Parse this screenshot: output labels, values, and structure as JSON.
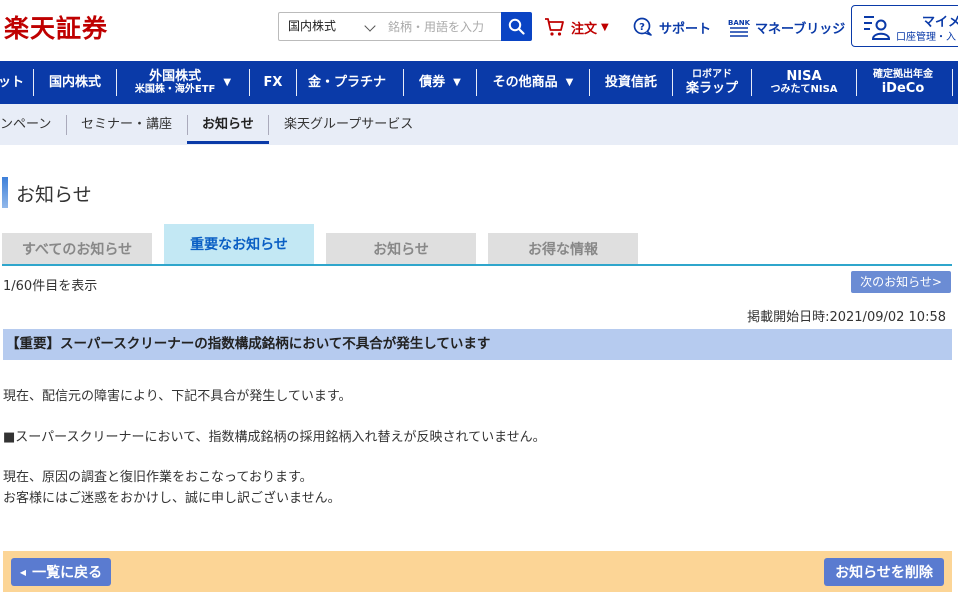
{
  "header": {
    "logo": "楽天証券",
    "search": {
      "category": "国内株式",
      "placeholder": "銘柄・用語を入力"
    },
    "order_label": "注文",
    "support_label": "サポート",
    "bridge_label": "マネーブリッジ",
    "mypage_title": "マイメ",
    "mypage_sub": "口座管理・入",
    "icons": {
      "search": "search-icon",
      "cart": "cart-icon",
      "support": "chat-question-icon",
      "bank": "bank-icon",
      "mypage": "user-list-icon"
    },
    "accent_color": "#bf0000",
    "brand_color": "#0a3aa8"
  },
  "main_nav": [
    {
      "label": "ット"
    },
    {
      "label": "国内株式"
    },
    {
      "label": "外国株式",
      "sub": "米国株・海外ETF",
      "caret": "▼"
    },
    {
      "label": "FX"
    },
    {
      "label": "金・プラチナ"
    },
    {
      "label": "債券",
      "caret": "▼"
    },
    {
      "label": "その他商品",
      "caret": "▼"
    },
    {
      "label": "投資信託"
    },
    {
      "label": "ロボアド",
      "sub": "楽ラップ"
    },
    {
      "label": "NISA",
      "sub": "つみたてNISA"
    },
    {
      "label": "確定拠出年金",
      "sub": "iDeCo"
    }
  ],
  "sub_nav": [
    "ンペーン",
    "セミナー・講座",
    "お知らせ",
    "楽天グループサービス"
  ],
  "page_title": "お知らせ",
  "tabs": [
    "すべてのお知らせ",
    "重要なお知らせ",
    "お知らせ",
    "お得な情報"
  ],
  "active_tab": "重要なお知らせ",
  "count_text": "1/60件目を表示",
  "next_label": "次のお知らせ>",
  "published": "掲載開始日時:2021/09/02 10:58",
  "notice": {
    "title": "【重要】スーパースクリーナーの指数構成銘柄において不具合が発生しています",
    "lines": [
      "現在、配信元の障害により、下記不具合が発生しています。",
      "■スーパースクリーナーにおいて、指数構成銘柄の採用銘柄入れ替えが反映されていません。",
      "現在、原因の調査と復旧作業をおこなっております。",
      "お客様にはご迷惑をおかけし、誠に申し訳ございません。"
    ]
  },
  "footer": {
    "back_label": "一覧に戻る",
    "back_arrow": "◀",
    "delete_label": "お知らせを削除"
  }
}
